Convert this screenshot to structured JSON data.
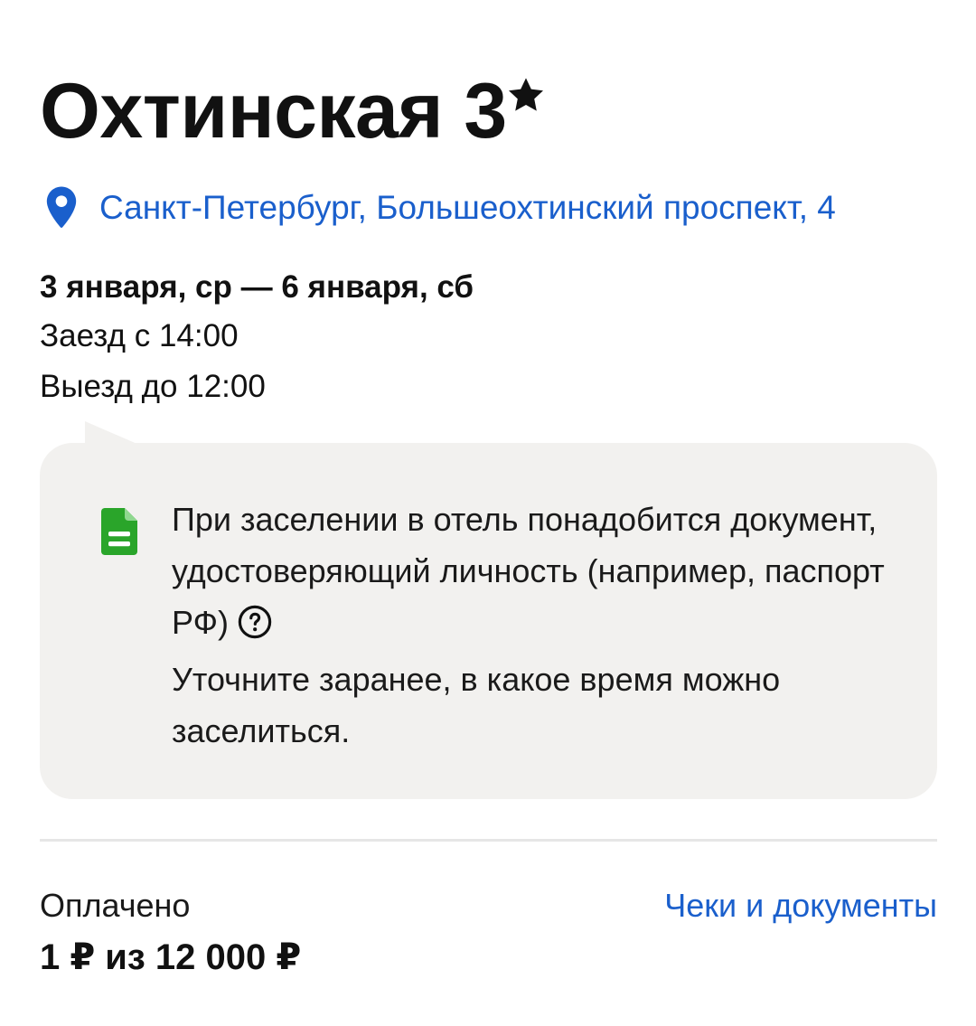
{
  "hotel": {
    "name": "Охтинская 3",
    "star_icon": "star-icon",
    "address": "Санкт-Петербург, Большеохтинский проспект, 4",
    "pin_icon": "location-pin-icon"
  },
  "stay": {
    "dates": "3 января, ср — 6 января, сб",
    "checkin": "Заезд с 14:00",
    "checkout": "Выезд до 12:00"
  },
  "notice": {
    "icon": "document-icon",
    "line1": "При заселении в отель понадобится документ, удостоверяющий  личность (например, паспорт РФ)",
    "help_icon": "question-circle-icon",
    "line2": "Уточните заранее, в какое время можно заселиться."
  },
  "payment": {
    "label": "Оплачено",
    "amount": "1 ₽ из 12 000 ₽",
    "receipts_link": "Чеки и документы"
  },
  "colors": {
    "link": "#1a5fcc",
    "card_bg": "#f2f1ef",
    "doc_icon": "#2aa52a",
    "text": "#111111"
  }
}
